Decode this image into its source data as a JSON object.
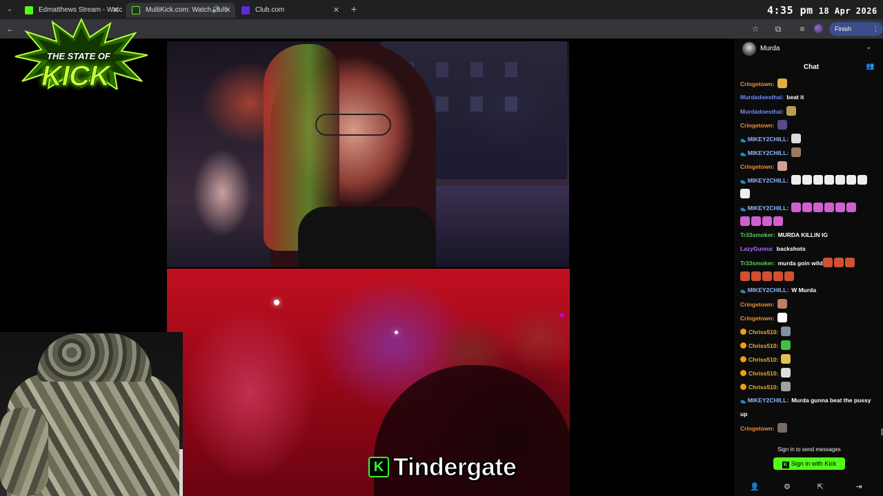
{
  "browser": {
    "tabs": [
      {
        "title": "Edmatthews Stream - Watch Li",
        "favicon_color": "#53fc18",
        "active": false
      },
      {
        "title": "MultiKick.com: Watch Multi",
        "favicon_color": "#2c2c2c",
        "active": true
      },
      {
        "title": "Club.com",
        "favicon_color": "#5b2bd8",
        "active": false
      }
    ],
    "finish_update_label": "Finish update"
  },
  "clock": {
    "time": "4:35 pm",
    "date": "18 Apr 2026"
  },
  "logo": {
    "line1": "THE STATE OF",
    "line2": "KICK"
  },
  "caption": {
    "icon": "K",
    "text": "Tindergate"
  },
  "chat": {
    "channel": "Murda",
    "title": "Chat",
    "messages": [
      {
        "user": "Cringetown:",
        "color": "#f0903a",
        "badge": "none",
        "text": "",
        "emotes": [
          "#e0b040"
        ]
      },
      {
        "user": "Murdadoesthai:",
        "color": "#6f8cff",
        "badge": "none",
        "text": "beat it",
        "emotes": []
      },
      {
        "user": "Murdadoesthai:",
        "color": "#6f8cff",
        "badge": "none",
        "text": "",
        "emotes": [
          "#b8a050"
        ]
      },
      {
        "user": "Cringetown:",
        "color": "#f0903a",
        "badge": "none",
        "text": "",
        "emotes": [
          "#5a4a8a"
        ]
      },
      {
        "user": "MIKEY2CHILL:",
        "color": "#8fb6ff",
        "badge": "sneaker",
        "text": "",
        "emotes": [
          "#dddddd"
        ]
      },
      {
        "user": "MIKEY2CHILL:",
        "color": "#8fb6ff",
        "badge": "sneaker",
        "text": "",
        "emotes": [
          "#9a7a60"
        ]
      },
      {
        "user": "Cringetown:",
        "color": "#f0903a",
        "badge": "none",
        "text": "",
        "emotes": [
          "#d0a090"
        ]
      },
      {
        "user": "MIKEY2CHILL:",
        "color": "#8fb6ff",
        "badge": "sneaker",
        "text": "",
        "emotes": [
          "#eeeeee",
          "#eeeeee",
          "#eeeeee",
          "#eeeeee",
          "#eeeeee",
          "#eeeeee",
          "#eeeeee"
        ]
      },
      {
        "user": "",
        "color": "#8fb6ff",
        "badge": "none",
        "text": "",
        "emotes": [
          "#eeeeee"
        ]
      },
      {
        "user": "MIKEY2CHILL:",
        "color": "#8fb6ff",
        "badge": "sneaker",
        "text": "",
        "emotes": [
          "#d060d0",
          "#d060d0",
          "#d060d0",
          "#d060d0",
          "#d060d0",
          "#d060d0"
        ]
      },
      {
        "user": "",
        "color": "#8fb6ff",
        "badge": "none",
        "text": "",
        "emotes": [
          "#d060d0",
          "#d060d0",
          "#d060d0",
          "#d060d0"
        ]
      },
      {
        "user": "Tr33smoker:",
        "color": "#5ad05a",
        "badge": "none",
        "text": "MURDA KILLIN IG",
        "emotes": []
      },
      {
        "user": "LazyGunna:",
        "color": "#b06aff",
        "badge": "none",
        "text": "backshots",
        "emotes": []
      },
      {
        "user": "Tr33smoker:",
        "color": "#5ad05a",
        "badge": "none",
        "text": "murda goin wild",
        "emotes": [
          "#d05030",
          "#d05030",
          "#d05030"
        ]
      },
      {
        "user": "",
        "color": "#5ad05a",
        "badge": "none",
        "text": "",
        "emotes": [
          "#d05030",
          "#d05030",
          "#d05030",
          "#d05030",
          "#d05030"
        ]
      },
      {
        "user": "MIKEY2CHILL:",
        "color": "#8fb6ff",
        "badge": "sneaker",
        "text": "W Murda",
        "emotes": []
      },
      {
        "user": "Cringetown:",
        "color": "#f0903a",
        "badge": "none",
        "text": "",
        "emotes": [
          "#c08060"
        ]
      },
      {
        "user": "Cringetown:",
        "color": "#f0903a",
        "badge": "none",
        "text": "",
        "emotes": [
          "#ffffff"
        ]
      },
      {
        "user": "Chriss510:",
        "color": "#f0b020",
        "badge": "coin",
        "text": "",
        "emotes": [
          "#8090a0"
        ]
      },
      {
        "user": "Chriss510:",
        "color": "#f0b020",
        "badge": "coin",
        "text": "",
        "emotes": [
          "#40c040"
        ]
      },
      {
        "user": "Chriss510:",
        "color": "#f0b020",
        "badge": "coin",
        "text": "",
        "emotes": [
          "#e0c050"
        ]
      },
      {
        "user": "Chriss510:",
        "color": "#f0b020",
        "badge": "coin",
        "text": "",
        "emotes": [
          "#dddddd"
        ]
      },
      {
        "user": "Chriss510:",
        "color": "#f0b020",
        "badge": "coin",
        "text": "",
        "emotes": [
          "#a0a0a0"
        ]
      },
      {
        "user": "MIKEY2CHILL:",
        "color": "#8fb6ff",
        "badge": "sneaker",
        "text": "Murda gunna beat the pussy",
        "emotes": []
      },
      {
        "user": "",
        "color": "#8fb6ff",
        "badge": "none",
        "text": "up",
        "emotes": []
      },
      {
        "user": "Cringetown:",
        "color": "#f0903a",
        "badge": "none",
        "text": "",
        "emotes": [
          "#7a6a6a"
        ]
      }
    ],
    "signin_note": "Sign in to send messages",
    "signin_button": "Sign in with Kick",
    "signin_button_icon": "K"
  },
  "colors": {
    "kick_green": "#53fc18",
    "browser_bg": "#1f2022",
    "chat_bg": "#0b0b0c"
  }
}
